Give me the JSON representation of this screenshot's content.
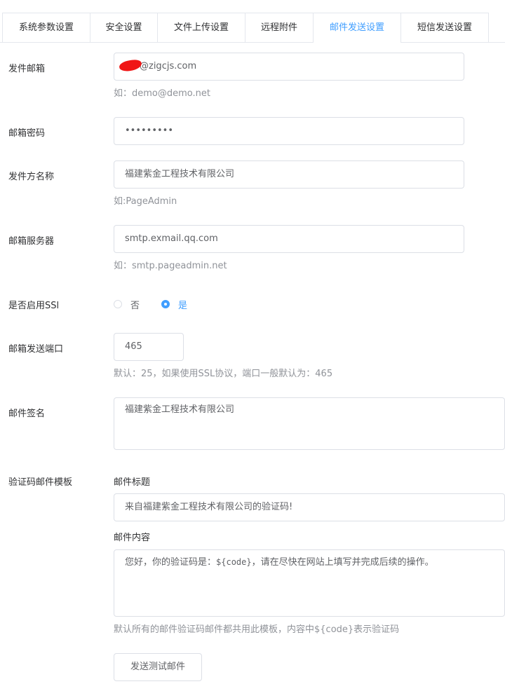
{
  "tabs": [
    {
      "label": "系统参数设置",
      "active": false
    },
    {
      "label": "安全设置",
      "active": false
    },
    {
      "label": "文件上传设置",
      "active": false
    },
    {
      "label": "远程附件",
      "active": false
    },
    {
      "label": "邮件发送设置",
      "active": true
    },
    {
      "label": "短信发送设置",
      "active": false
    }
  ],
  "form": {
    "sender_email": {
      "label": "发件邮箱",
      "value": "@zigcjs.com",
      "hint": "如：demo@demo.net"
    },
    "email_password": {
      "label": "邮箱密码",
      "value": "•••••••••"
    },
    "sender_name": {
      "label": "发件方名称",
      "value": "福建紫金工程技术有限公司",
      "hint": "如:PageAdmin"
    },
    "mail_server": {
      "label": "邮箱服务器",
      "value": "smtp.exmail.qq.com",
      "hint": "如：smtp.pageadmin.net"
    },
    "ssl": {
      "label": "是否启用SSl",
      "options": [
        "否",
        "是"
      ],
      "selected": "是"
    },
    "port": {
      "label": "邮箱发送端口",
      "value": "465",
      "hint": "默认：25，如果使用SSL协议，端口一般默认为：465"
    },
    "signature": {
      "label": "邮件签名",
      "value": "福建紫金工程技术有限公司"
    },
    "template": {
      "label": "验证码邮件模板",
      "subject_label": "邮件标题",
      "subject_value": "来自福建紫金工程技术有限公司的验证码!",
      "content_label": "邮件内容",
      "content_prefix": "您好，你的验证码是：",
      "content_code": "${code}",
      "content_suffix": "，请在尽快在网站上填写并完成后续的操作。",
      "hint": "默认所有的邮件验证码邮件都共用此模板，内容中${code}表示验证码"
    },
    "test_button": "发送测试邮件"
  },
  "colors": {
    "accent": "#409eff",
    "redaction": "#f01616"
  }
}
